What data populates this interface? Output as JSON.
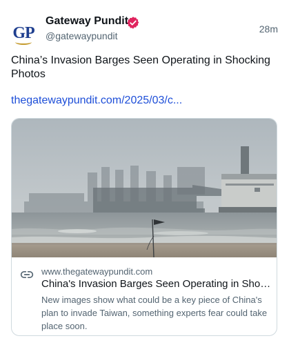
{
  "author": {
    "avatar_text": "GP",
    "name": "Gateway Pundit",
    "handle": "@gatewaypundit",
    "verified_icon": "verified-badge-icon"
  },
  "post": {
    "timestamp": "28m",
    "text": "China’s Invasion Barges Seen Operating in Shocking Photos",
    "link_text": "thegatewaypundit.com/2025/03/c..."
  },
  "card": {
    "domain": "www.thegatewaypundit.com",
    "title": "China's Invasion Barges Seen Operating in Shocking Photos",
    "description": "New images show what could be a key piece of China's plan to invade Taiwan, something experts fear could take place soon.",
    "link_icon": "link-icon"
  },
  "colors": {
    "link": "#1d4ed8",
    "verified": "#e0245e",
    "muted": "#536471",
    "avatar_blue": "#1f3f8f"
  }
}
